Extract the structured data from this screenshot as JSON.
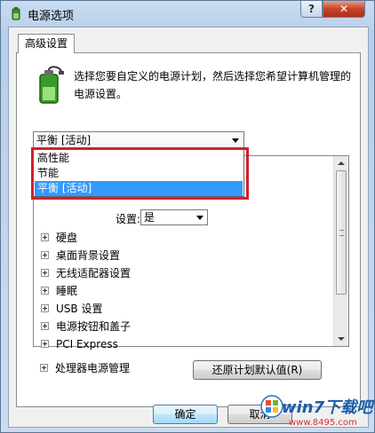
{
  "window": {
    "title": "电源选项",
    "help_label": "?",
    "close_label": "✕"
  },
  "tabs": [
    {
      "label": "高级设置"
    }
  ],
  "description": "选择您要自定义的电源计划，然后选择您希望计算机管理的电源设置。",
  "plan_select": {
    "value": "平衡 [活动]",
    "options": [
      {
        "label": "高性能"
      },
      {
        "label": "节能"
      },
      {
        "label": "平衡 [活动]"
      }
    ]
  },
  "partial_setting": {
    "label": "设置:",
    "value": "是"
  },
  "tree_items": [
    {
      "label": "硬盘"
    },
    {
      "label": "桌面背景设置"
    },
    {
      "label": "无线适配器设置"
    },
    {
      "label": "睡眠"
    },
    {
      "label": "USB 设置"
    },
    {
      "label": "电源按钮和盖子"
    },
    {
      "label": "PCI Express"
    },
    {
      "label": "处理器电源管理"
    }
  ],
  "buttons": {
    "restore": "还原计划默认值(R)",
    "ok": "确定",
    "cancel": "取消"
  },
  "watermark": {
    "brand": "win7下载吧",
    "url": "www.8495.com"
  },
  "colors": {
    "selection": "#3399ff",
    "highlight_box": "#d0212c",
    "close_button": "#c8432a"
  }
}
